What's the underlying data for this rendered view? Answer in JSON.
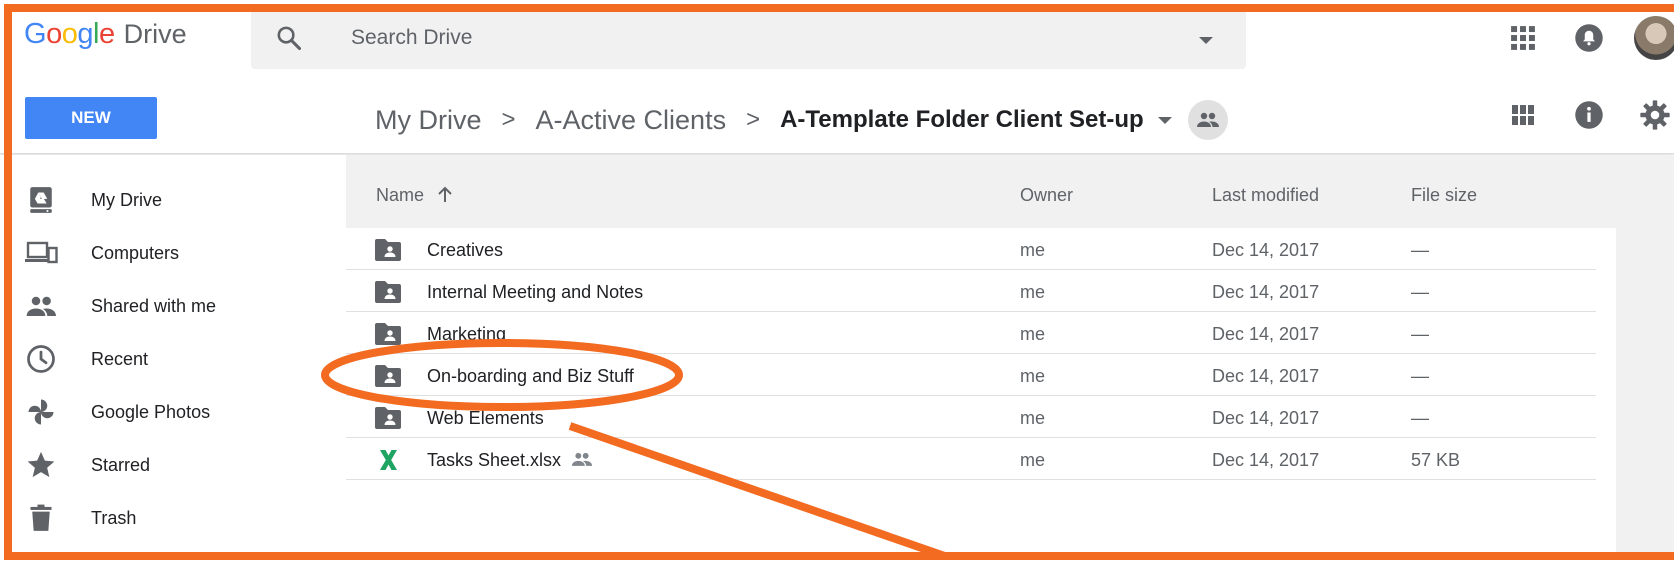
{
  "app": {
    "logo_letters": [
      "G",
      "o",
      "o",
      "g",
      "l",
      "e"
    ],
    "product": "Drive"
  },
  "search": {
    "placeholder": "Search Drive",
    "value": ""
  },
  "header_icons": [
    "apps-grid-icon",
    "notifications-icon",
    "account-avatar"
  ],
  "toolbar": {
    "new_label": "NEW",
    "breadcrumb": [
      "My Drive",
      "A-Active Clients"
    ],
    "current_folder": "A-Template Folder Client Set-up",
    "separator": ">",
    "right_icons": [
      "grid-view-icon",
      "info-icon",
      "settings-icon"
    ]
  },
  "sidebar": {
    "items": [
      {
        "label": "My Drive",
        "icon": "my-drive-icon"
      },
      {
        "label": "Computers",
        "icon": "computers-icon"
      },
      {
        "label": "Shared with me",
        "icon": "shared-people-icon"
      },
      {
        "label": "Recent",
        "icon": "clock-icon"
      },
      {
        "label": "Google Photos",
        "icon": "photos-pinwheel-icon"
      },
      {
        "label": "Starred",
        "icon": "star-icon"
      },
      {
        "label": "Trash",
        "icon": "trash-icon"
      }
    ]
  },
  "list": {
    "columns": {
      "name": "Name",
      "owner": "Owner",
      "modified": "Last modified",
      "size": "File size"
    },
    "sort": "name-ascending",
    "rows": [
      {
        "name": "Creatives",
        "type": "shared-folder",
        "owner": "me",
        "modified": "Dec 14, 2017",
        "size": "—"
      },
      {
        "name": "Internal Meeting and Notes",
        "type": "shared-folder",
        "owner": "me",
        "modified": "Dec 14, 2017",
        "size": "—"
      },
      {
        "name": "Marketing",
        "type": "shared-folder",
        "owner": "me",
        "modified": "Dec 14, 2017",
        "size": "—"
      },
      {
        "name": "On-boarding and Biz Stuff",
        "type": "shared-folder",
        "owner": "me",
        "modified": "Dec 14, 2017",
        "size": "—"
      },
      {
        "name": "Web Elements",
        "type": "shared-folder",
        "owner": "me",
        "modified": "Dec 14, 2017",
        "size": "—"
      },
      {
        "name": "Tasks Sheet.xlsx",
        "type": "excel-file",
        "shared": true,
        "owner": "me",
        "modified": "Dec 14, 2017",
        "size": "57 KB"
      }
    ]
  },
  "annotation": {
    "color": "#f26b21",
    "highlighted_row": "On-boarding and Biz Stuff"
  },
  "colors": {
    "accent": "#4285f4",
    "excel": "#1fa463",
    "icon_gray": "#5f6368"
  }
}
